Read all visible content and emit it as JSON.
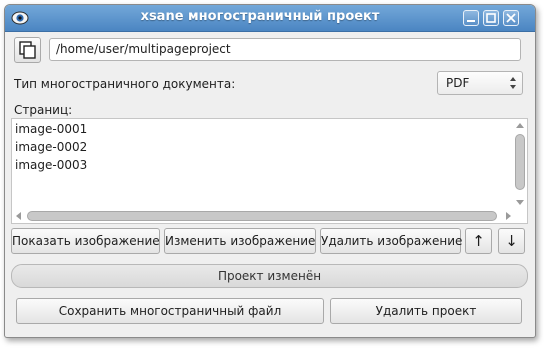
{
  "window": {
    "title": "xsane многостраничный проект"
  },
  "project": {
    "path": "/home/user/multipageproject"
  },
  "doc_type": {
    "label": "Тип многостраничного документа:",
    "selected": "PDF"
  },
  "pages": {
    "label": "Страниц:",
    "items": [
      "image-0001",
      "image-0002",
      "image-0003"
    ]
  },
  "actions": {
    "show_image": "Показать изображение",
    "edit_image": "Изменить изображение",
    "delete_image": "Удалить изображение",
    "move_up": "↑",
    "move_down": "↓"
  },
  "status": {
    "text": "Проект изменён"
  },
  "footer": {
    "save_file": "Сохранить многостраничный файл",
    "delete_project": "Удалить проект"
  },
  "colors": {
    "titlebar": "#4b85c2",
    "background": "#efefef"
  }
}
